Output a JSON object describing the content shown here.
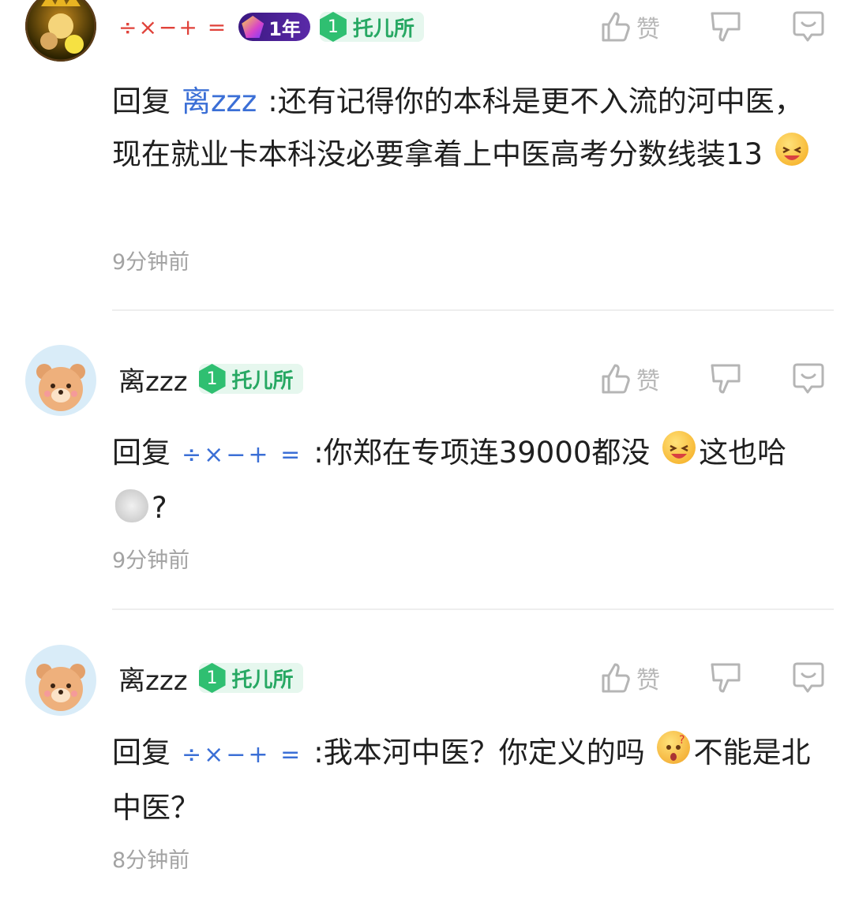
{
  "comments": [
    {
      "username": "÷×−+ =",
      "year_badge": "1年",
      "level": "1",
      "level_title": "托儿所",
      "like_label": "赞",
      "reply_prefix": "回复",
      "mention": "离zzz",
      "content_1": ":还有记得你的本科是更不入流的河中医，现在就业卡本科没必要拿着上中医高考分数线装13",
      "content_2": "",
      "time": "9分钟前"
    },
    {
      "username": "离zzz",
      "level": "1",
      "level_title": "托儿所",
      "like_label": "赞",
      "reply_prefix": "回复",
      "mention": "÷×−+ =",
      "content_1": ":你郑在专项连39000都没",
      "content_2": "这也哈",
      "content_3": "?",
      "time": "9分钟前"
    },
    {
      "username": "离zzz",
      "level": "1",
      "level_title": "托儿所",
      "like_label": "赞",
      "reply_prefix": "回复",
      "mention": "÷×−+ =",
      "content_1": ":我本河中医？你定义的吗",
      "content_2": "不能是北中医？",
      "time": "8分钟前"
    }
  ],
  "icons": {
    "like": "thumbs-up-icon",
    "dislike": "thumbs-down-icon",
    "reply": "comment-bubble-icon",
    "emoji_1": "laughing-emoji",
    "emoji_2": "laughing-emoji",
    "emoji_3": "smoke-puff-emoji",
    "emoji_4": "thinking-emoji"
  },
  "colors": {
    "mention_blue": "#3b6fd6",
    "level_green": "#2fbf71",
    "muted_gray": "#a3a3a3"
  }
}
